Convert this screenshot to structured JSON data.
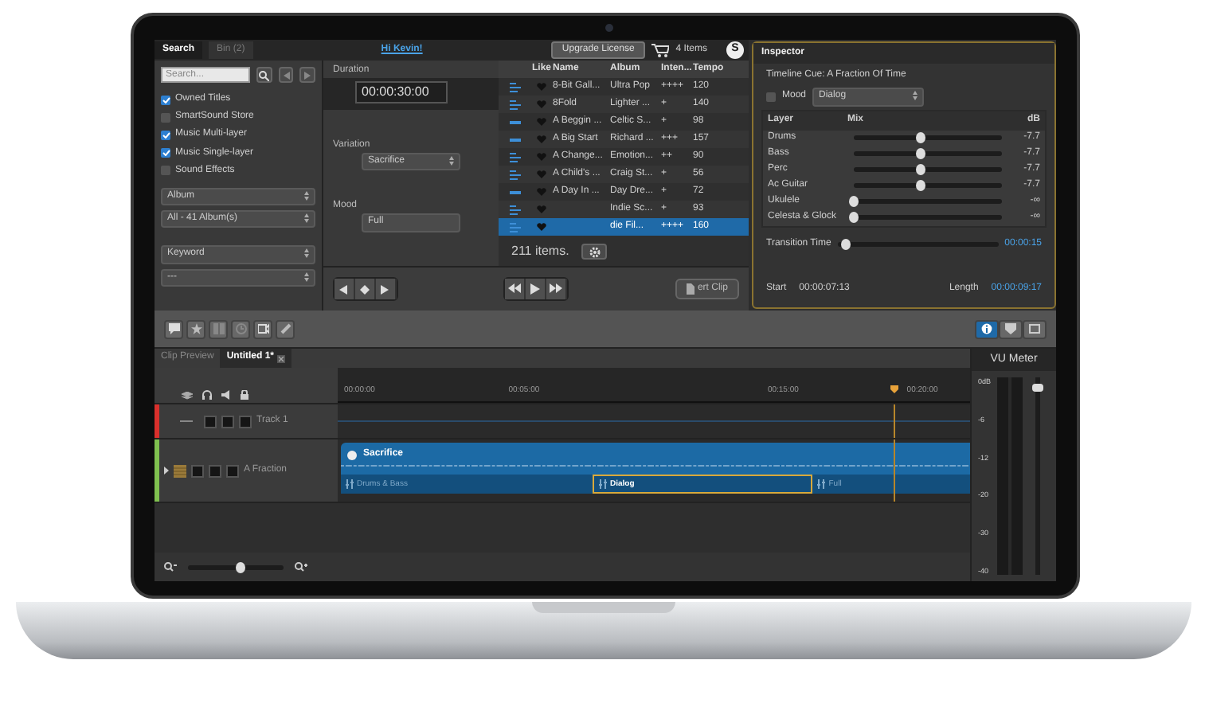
{
  "search_panel": {
    "tabs": [
      {
        "label": "Search",
        "selected": true
      },
      {
        "label": "Bin (2)",
        "selected": false
      }
    ],
    "search": {
      "placeholder": "Search..."
    },
    "filters": [
      {
        "label": "Owned Titles",
        "checked": true
      },
      {
        "label": "SmartSound Store",
        "checked": false
      },
      {
        "label": "Music Multi-layer",
        "checked": true
      },
      {
        "label": "Music Single-layer",
        "checked": true
      },
      {
        "label": "Sound Effects",
        "checked": false
      }
    ],
    "dropdowns": [
      "Album",
      "All - 41 Album(s)",
      "Keyword",
      "---"
    ]
  },
  "header": {
    "greeting": "Hi Kevin!",
    "upgrade_button": "Upgrade License",
    "cart": "4 Items",
    "logo": "S"
  },
  "clip_panel": {
    "duration_label": "Duration",
    "duration": "00:00:30:00",
    "variation_label": "Variation",
    "variation": "Sacrifice",
    "mood_label": "Mood",
    "mood": "Full"
  },
  "results": {
    "columns": [
      "Like",
      "Name",
      "Album",
      "Inten...",
      "Tempo"
    ],
    "rows": [
      {
        "kind": "multi",
        "name": "8-Bit Gall...",
        "album": "Ultra Pop",
        "intensity": "++++",
        "tempo": "120",
        "selected": false
      },
      {
        "kind": "multi",
        "name": "8Fold",
        "album": "Lighter ...",
        "intensity": "+",
        "tempo": "140",
        "selected": false
      },
      {
        "kind": "single",
        "name": "A Beggin ...",
        "album": "Celtic S...",
        "intensity": "+",
        "tempo": "98",
        "selected": false
      },
      {
        "kind": "single",
        "name": "A Big Start",
        "album": "Richard ...",
        "intensity": "+++",
        "tempo": "157",
        "selected": false
      },
      {
        "kind": "multi",
        "name": "A Change...",
        "album": "Emotion...",
        "intensity": "++",
        "tempo": "90",
        "selected": false
      },
      {
        "kind": "multi",
        "name": "A Child's ...",
        "album": "Craig St...",
        "intensity": "+",
        "tempo": "56",
        "selected": false
      },
      {
        "kind": "single",
        "name": "A Day In ...",
        "album": "Day Dre...",
        "intensity": "+",
        "tempo": "72",
        "selected": false
      },
      {
        "kind": "multi",
        "name": "",
        "album": "Indie Sc...",
        "intensity": "+",
        "tempo": "93",
        "selected": false
      },
      {
        "kind": "multi",
        "name": "",
        "album": "die Fil...",
        "intensity": "++++",
        "tempo": "160",
        "selected": true
      }
    ],
    "count": "211 items."
  },
  "transport": {
    "insert_button": "ert Clip"
  },
  "inspector": {
    "title": "Inspector",
    "cue": "Timeline Cue: A Fraction Of Time",
    "mood_label": "Mood",
    "mood_checked": false,
    "mood": "Dialog",
    "columns": [
      "Layer",
      "Mix",
      "dB"
    ],
    "layers": [
      {
        "name": "Drums",
        "level": 0.45,
        "db": "-7.7"
      },
      {
        "name": "Bass",
        "level": 0.45,
        "db": "-7.7"
      },
      {
        "name": "Perc",
        "level": 0.45,
        "db": "-7.7"
      },
      {
        "name": "Ac Guitar",
        "level": 0.45,
        "db": "-7.7"
      },
      {
        "name": "Ukulele",
        "level": 0,
        "db": "-∞"
      },
      {
        "name": "Celesta & Glock",
        "level": 0,
        "db": "-∞"
      }
    ],
    "transition_label": "Transition Time",
    "transition": {
      "level": 0.05
    },
    "transition_value": "00:00:15",
    "start_label": "Start",
    "start": "00:00:07:13",
    "length_label": "Length",
    "length": "00:00:09:17"
  },
  "view_buttons": [
    {
      "kind": "info",
      "selected": true
    },
    {
      "kind": "marker",
      "selected": false
    },
    {
      "kind": "screen",
      "selected": false
    }
  ],
  "timeline": {
    "tabs": [
      {
        "label": "Clip Preview",
        "selected": false
      },
      {
        "label": "Untitled 1*",
        "selected": true
      }
    ],
    "ruler": [
      "00:00:00",
      "00:05:00",
      "00:15:00",
      "00:20:00"
    ],
    "tracks": [
      {
        "name": "Track 1",
        "color": "#d9302c",
        "kind": "empty"
      },
      {
        "name": "A Fraction",
        "color": "#7fc04f",
        "kind": "clip",
        "clip": "Sacrifice",
        "segments": [
          {
            "label": "Drums & Bass",
            "selected": false
          },
          {
            "label": "Dialog",
            "selected": true
          },
          {
            "label": "Full",
            "selected": false
          }
        ]
      }
    ],
    "zoom": {
      "level": 0.55
    }
  },
  "vu_meter": {
    "title": "VU Meter",
    "scale": [
      "0dB",
      "-6",
      "-12",
      "-20",
      "-30",
      "-40"
    ],
    "volume": {
      "level": 0.97
    }
  }
}
